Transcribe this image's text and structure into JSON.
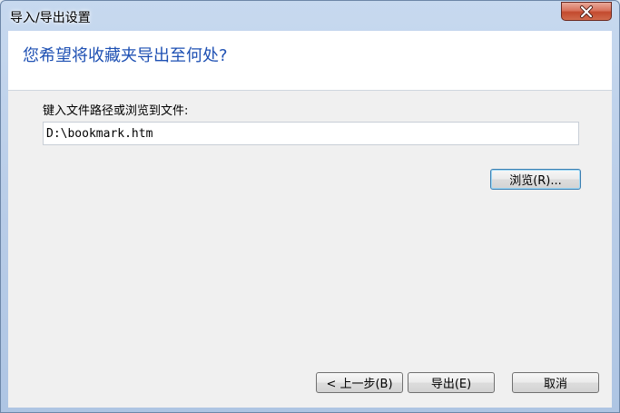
{
  "window": {
    "title": "导入/导出设置"
  },
  "header": {
    "question": "您希望将收藏夹导出至何处?"
  },
  "form": {
    "path_label": "键入文件路径或浏览到文件:",
    "path_value": "D:\\bookmark.htm",
    "browse_label": "浏览(R)..."
  },
  "footer": {
    "back_label": "< 上一步(B)",
    "export_label": "导出(E)",
    "cancel_label": "取消"
  },
  "icons": {
    "close": "close-icon"
  },
  "colors": {
    "header_text": "#1e50b3",
    "close_button": "#c34a2e",
    "title_bar": "#c7d9ef"
  }
}
